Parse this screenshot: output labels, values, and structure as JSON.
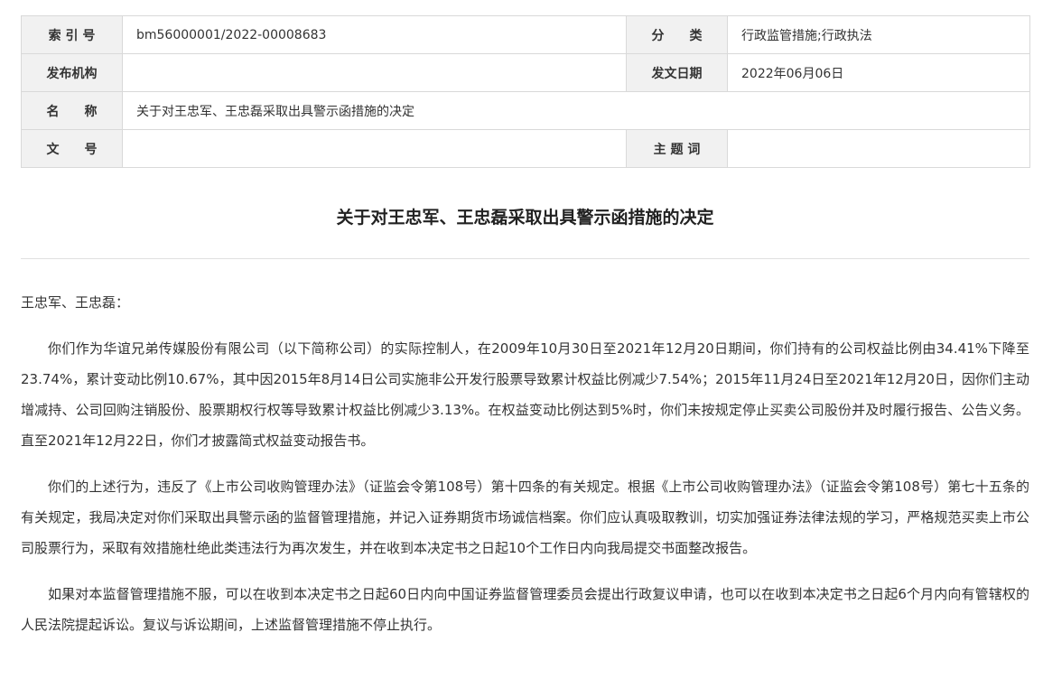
{
  "meta": {
    "index_label": "索 引 号",
    "index_value": "bm56000001/2022-00008683",
    "category_label": "分　　类",
    "category_value": "行政监管措施;行政执法",
    "publisher_label": "发布机构",
    "publisher_value": "",
    "date_label": "发文日期",
    "date_value": "2022年06月06日",
    "name_label": "名　　称",
    "name_value": "关于对王忠军、王忠磊采取出具警示函措施的决定",
    "docno_label": "文　　号",
    "docno_value": "",
    "keywords_label": "主 题 词",
    "keywords_value": ""
  },
  "document": {
    "title": "关于对王忠军、王忠磊采取出具警示函措施的决定",
    "salutation": "王忠军、王忠磊：",
    "paragraphs": [
      "你们作为华谊兄弟传媒股份有限公司（以下简称公司）的实际控制人，在2009年10月30日至2021年12月20日期间，你们持有的公司权益比例由34.41%下降至23.74%，累计变动比例10.67%，其中因2015年8月14日公司实施非公开发行股票导致累计权益比例减少7.54%；2015年11月24日至2021年12月20日，因你们主动增减持、公司回购注销股份、股票期权行权等导致累计权益比例减少3.13%。在权益变动比例达到5%时，你们未按规定停止买卖公司股份并及时履行报告、公告义务。直至2021年12月22日，你们才披露简式权益变动报告书。",
      "你们的上述行为，违反了《上市公司收购管理办法》（证监会令第108号）第十四条的有关规定。根据《上市公司收购管理办法》（证监会令第108号）第七十五条的有关规定，我局决定对你们采取出具警示函的监督管理措施，并记入证券期货市场诚信档案。你们应认真吸取教训，切实加强证券法律法规的学习，严格规范买卖上市公司股票行为，采取有效措施杜绝此类违法行为再次发生，并在收到本决定书之日起10个工作日内向我局提交书面整改报告。",
      "如果对本监督管理措施不服，可以在收到本决定书之日起60日内向中国证券监督管理委员会提出行政复议申请，也可以在收到本决定书之日起6个月内向有管辖权的人民法院提起诉讼。复议与诉讼期间，上述监督管理措施不停止执行。"
    ]
  }
}
